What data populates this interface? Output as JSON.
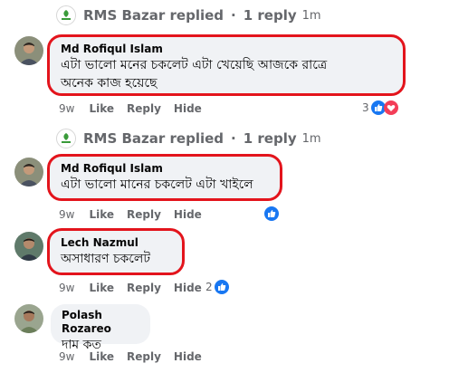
{
  "threads": [
    {
      "reply_summary": {
        "author": "RMS Bazar replied",
        "sep": "·",
        "count": "1 reply",
        "time": "1m"
      },
      "comment": {
        "author": "Md Rofiqul Islam",
        "text_line1": "এটা ভালো মনের চকলেট এটা খেয়েছি আজকে রাত্রে",
        "text_line2": "অনেক কাজ হয়েছে"
      },
      "actions": {
        "age": "9w",
        "like": "Like",
        "reply": "Reply",
        "hide": "Hide"
      },
      "reactions": {
        "count": "3",
        "types": [
          "like-icon",
          "love-icon"
        ]
      }
    },
    {
      "reply_summary": {
        "author": "RMS Bazar replied",
        "sep": "·",
        "count": "1 reply",
        "time": "1m"
      },
      "comment": {
        "author": "Md Rofiqul Islam",
        "text_line1": "এটা ভালো মানের চকলেট এটা খাইলে"
      },
      "actions": {
        "age": "9w",
        "like": "Like",
        "reply": "Reply",
        "hide": "Hide"
      },
      "reactions": {
        "count": "",
        "types": [
          "like-icon"
        ]
      }
    },
    {
      "comment": {
        "author": "Lech Nazmul",
        "text_line1": "অসাধারণ চকলেট"
      },
      "actions": {
        "age": "9w",
        "like": "Like",
        "reply": "Reply",
        "hide": "Hide"
      },
      "reactions": {
        "count": "2",
        "types": [
          "like-icon"
        ]
      }
    },
    {
      "comment": {
        "author": "Polash Rozareo",
        "text_line1": "দাম কত"
      },
      "actions": {
        "age": "9w",
        "like": "Like",
        "reply": "Reply",
        "hide": "Hide"
      }
    }
  ],
  "colors": {
    "highlight_border": "#e3141c",
    "bubble_bg": "#f0f2f5",
    "like_blue": "#1877f2",
    "love_red": "#f33e58",
    "meta_gray": "#65676b"
  }
}
